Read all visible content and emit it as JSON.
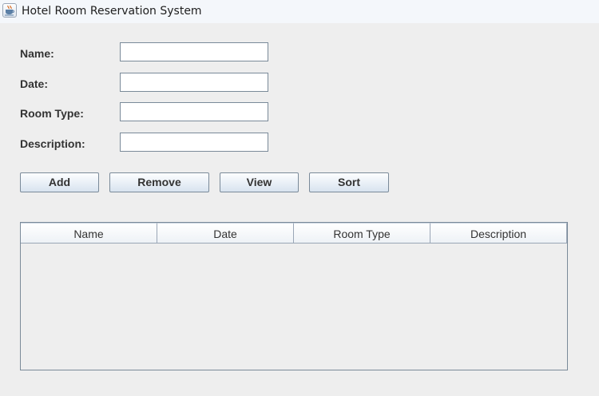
{
  "window": {
    "title": "Hotel Room Reservation System",
    "icon": "java-cup-icon"
  },
  "form": {
    "fields": [
      {
        "label": "Name:",
        "value": ""
      },
      {
        "label": "Date:",
        "value": ""
      },
      {
        "label": "Room Type:",
        "value": ""
      },
      {
        "label": "Description:",
        "value": ""
      }
    ]
  },
  "buttons": {
    "add": "Add",
    "remove": "Remove",
    "view": "View",
    "sort": "Sort"
  },
  "table": {
    "columns": [
      "Name",
      "Date",
      "Room Type",
      "Description"
    ],
    "rows": []
  }
}
